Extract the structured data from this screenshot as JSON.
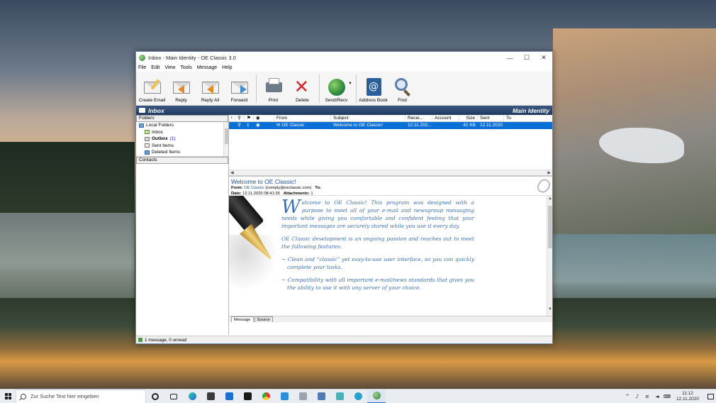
{
  "window": {
    "title": "Inbox - Main Identity - OE Classic 3.0",
    "controls": {
      "minimize": "—",
      "maximize": "☐",
      "close": "✕"
    }
  },
  "menu": [
    "File",
    "Edit",
    "View",
    "Tools",
    "Message",
    "Help"
  ],
  "toolbar": {
    "create_email": "Create Email",
    "reply": "Reply",
    "reply_all": "Reply All",
    "forward": "Forward",
    "print": "Print",
    "delete": "Delete",
    "send_recv": "Send/Recv",
    "address_book": "Address Book",
    "find": "Find"
  },
  "header_bar": {
    "folder": "Inbox",
    "identity": "Main Identity"
  },
  "left_pane": {
    "folders_label": "Folders",
    "folders": [
      {
        "name": "Local Folders",
        "icon": "local-folders-icon"
      },
      {
        "name": "Inbox",
        "icon": "inbox-folder-icon"
      },
      {
        "name": "Outbox",
        "icon": "outbox-folder-icon",
        "count": "(1)"
      },
      {
        "name": "Sent Items",
        "icon": "sent-folder-icon"
      },
      {
        "name": "Deleted Items",
        "icon": "deleted-folder-icon"
      }
    ],
    "contacts_label": "Contacts"
  },
  "message_list": {
    "columns": [
      "From",
      "Subject",
      "Recei...",
      "Account",
      "Size",
      "Sent",
      "To"
    ],
    "rows": [
      {
        "num": "1",
        "from": "OE Classic",
        "subject": "Welcome to OE Classic!",
        "received": "12.11.202...",
        "account": "",
        "size": "42 KB",
        "sent": "12.11.2020",
        "to": ""
      }
    ]
  },
  "preview": {
    "subject": "Welcome to OE Classic!",
    "from_label": "From:",
    "from_name": "OE Classic",
    "from_email": "(noreply@oeclassic.com)",
    "to_label": "To:",
    "date_label": "Date:",
    "date_value": "12.11.2020 08:41:35",
    "attachments_label": "Attachments:",
    "attachments_value": "1",
    "body": {
      "p1_cap": "W",
      "p1": "elcome to OE Classic! This program was designed with a purpose to meet all of your e-mail and newsgroup messaging needs while giving you comfortable and confident feeling that your important messages are securely stored while you use it every day.",
      "p2": "OE Classic development is an ongoing passion and reaches out to meet the following features:",
      "b1": "~ Clean and “classic” yet easy-to-use user interface, so you can quickly complete your tasks.",
      "b2": "~ Compatibility with all important e-mail/news standards that gives you the ability to use it with any server of your choice."
    },
    "tabs": [
      "Message",
      "Source"
    ]
  },
  "status": {
    "text": "1 message, 0 unread"
  },
  "taskbar": {
    "search_placeholder": "Zur Suche Text hier eingeben",
    "time": "11:12",
    "date": "12.11.2020"
  },
  "colors": {
    "selection": "#0a6fd6",
    "header_bar": "#1f3a60",
    "body_text": "#3c6fae"
  }
}
